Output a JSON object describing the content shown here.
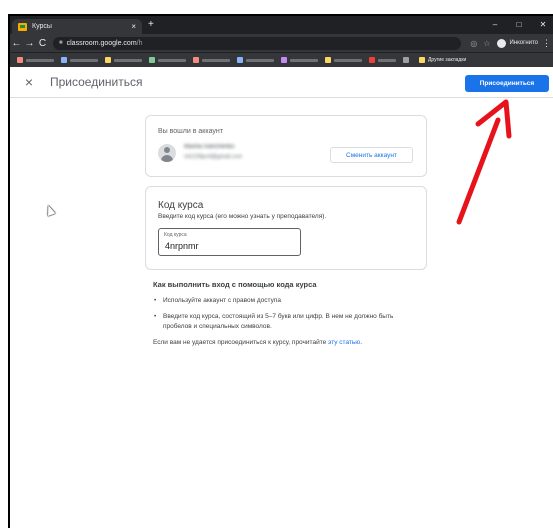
{
  "browser": {
    "tab_title": "Курсы",
    "tab_close": "×",
    "new_tab": "+",
    "win_min": "–",
    "win_max": "□",
    "win_close": "✕",
    "url_host": "classroom.google.com",
    "url_rest": "/h",
    "incognito_label": "Инкогнито",
    "bookmarks_other": "Другие закладки"
  },
  "app": {
    "close_icon": "×",
    "title": "Присоединиться",
    "join_button": "Присоединиться"
  },
  "account": {
    "signed_in_label": "Вы вошли в аккаунт",
    "name": "Masha Ivanchenko",
    "email": "ml1228prof@gmail.com",
    "switch_button": "Сменить аккаунт"
  },
  "course": {
    "title": "Код курса",
    "subtitle": "Введите код курса (его можно узнать у преподавателя).",
    "field_label": "Код курса",
    "field_value": "4nrpnmr"
  },
  "help": {
    "title": "Как выполнить вход с помощью кода курса",
    "items": [
      "Используйте аккаунт с правом доступа",
      "Введите код курса, состоящий из 5–7 букв или цифр. В нем не должно быть пробелов и специальных символов."
    ],
    "footer_text": "Если вам не удается присоединиться к курсу, прочитайте ",
    "footer_link": "эту статью",
    "footer_end": "."
  },
  "colors": {
    "accent": "#1a73e8",
    "annotation_arrow": "#e8121b"
  }
}
